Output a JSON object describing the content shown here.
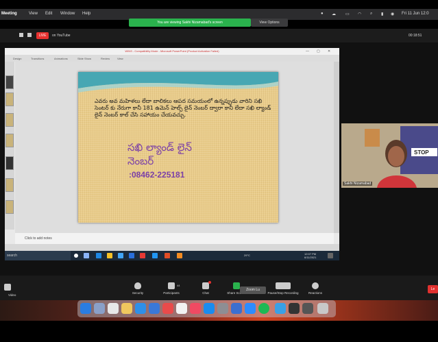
{
  "menubar": {
    "app": "Meeting",
    "items": [
      "View",
      "Edit",
      "Window",
      "Help"
    ],
    "clock": "Fri 11 Jun 12:0"
  },
  "share_banner": {
    "text": "You are viewing Sakhi Nizamabad's screen",
    "view_options": "View Options"
  },
  "zoom_top": {
    "live_label": "LIVE",
    "youtube_label": "on YouTube",
    "timer": "00:18:51"
  },
  "ppt": {
    "title": "WINS - Compatibility Mode - Microsoft PowerPoint (Product Activation Failed)",
    "ribbon_tabs": [
      "Design",
      "Transitions",
      "Animations",
      "Slide Show",
      "Review",
      "View"
    ],
    "notes_placeholder": "Click to add notes"
  },
  "slide": {
    "body": "ఎవరు అవ మహిళలు లేదా బాలికలు ఆపద సమయంలో ఉన్నప్పుడు వారిని సఖి సెంటర్ కు నేరుగా కానీ 181 ఉమెన్ హెల్ప్ లైన్ నెంబర్ ద్వారా కానీ లేదా సఖి ల్యాండ్ లైన్ నెంబర్ కాల్ చేసి సహాయం చేయవచ్చు.",
    "heading_line1": "సఖి ల్యాండ్ లైన్",
    "heading_line2": "నెంబర్",
    "phone": ":08462-225181"
  },
  "taskbar": {
    "search_placeholder": "search",
    "temperature": "29°C",
    "time": "12:07 PM",
    "date": "6/11/2021"
  },
  "video": {
    "participant_name": "Sakhi Nizamabad",
    "banner_text": "STOP"
  },
  "zoombar": {
    "video_label": "Video",
    "buttons": [
      "Security",
      "Participants",
      "Chat",
      "Share Screen",
      "Pause/Stop Recording",
      "Reactions"
    ],
    "participants_count": "44",
    "shortcut_tip": "Zoom Lu",
    "leave_label": "Le"
  },
  "colors": {
    "share_green": "#2ab24d",
    "live_red": "#e8312f",
    "slide_text_purple": "#7a3fa8",
    "slide_bg": "#e9cc8a"
  }
}
